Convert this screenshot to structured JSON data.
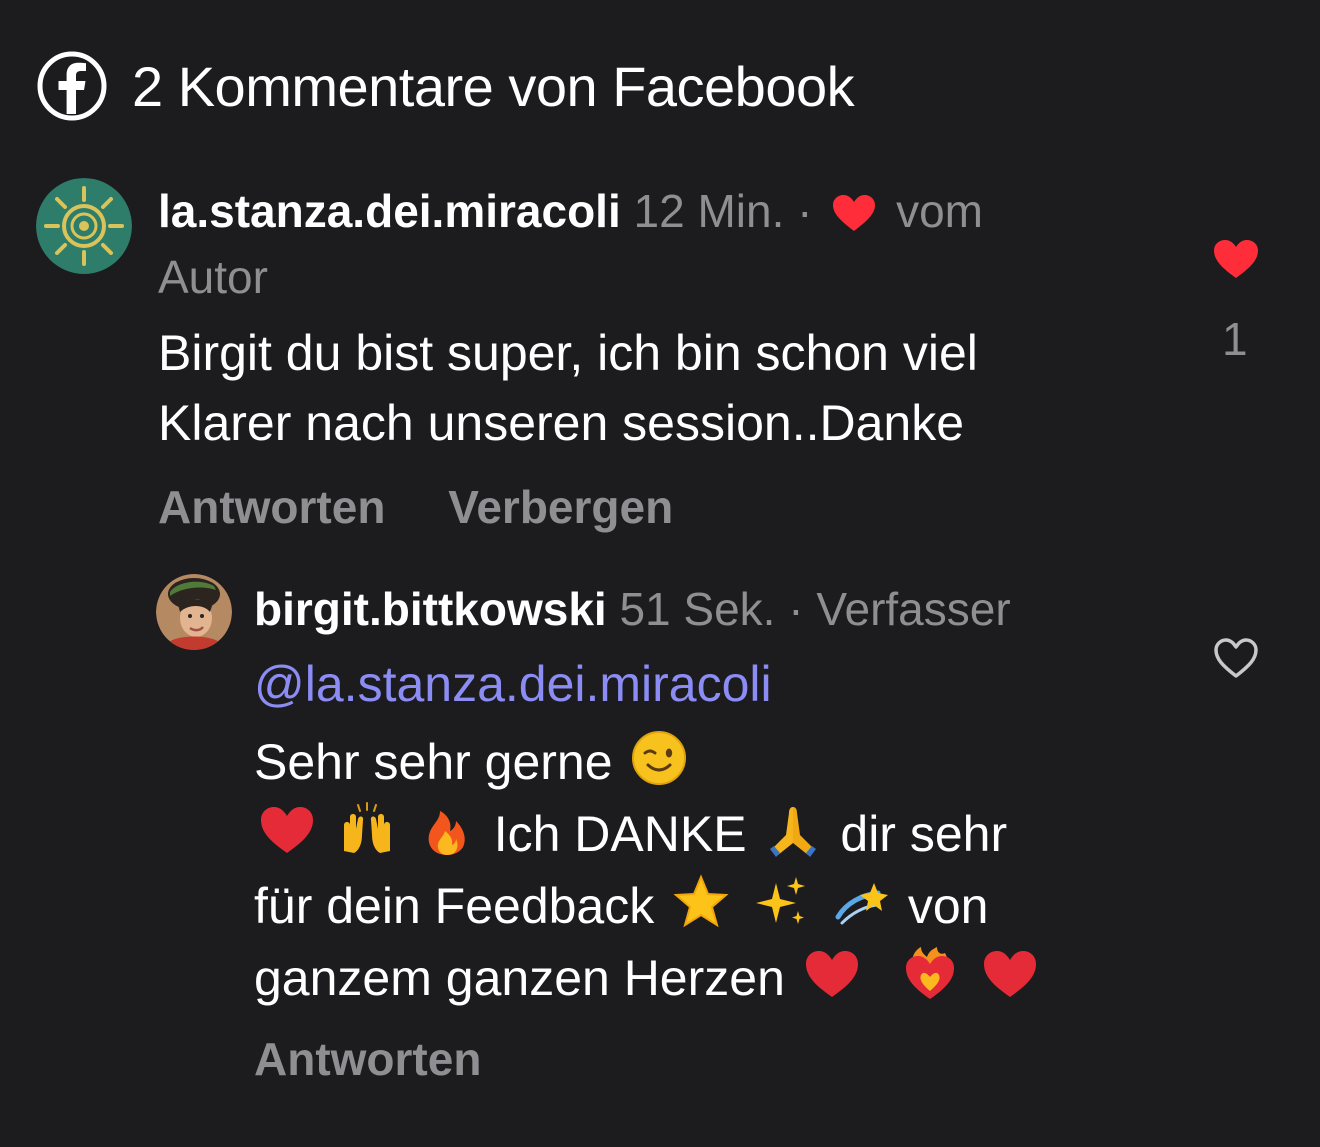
{
  "header": {
    "icon": "facebook-icon",
    "title": "2 Kommentare von Facebook"
  },
  "comments": [
    {
      "username": "la.stanza.dei.miracoli",
      "time": "12 Min.",
      "separator": "·",
      "liked_by_author_prefix": "vom",
      "liked_by_author_suffix": "Autor",
      "text_line1": "Birgit du bist super, ich bin schon viel",
      "text_line2": "Klarer nach unseren session..Danke",
      "actions": {
        "reply": "Antworten",
        "hide": "Verbergen"
      },
      "like_state": "liked",
      "like_count": "1"
    },
    {
      "username": "birgit.bittkowski",
      "time": "51 Sek.",
      "separator": "·",
      "role": "Verfasser",
      "mention": "@la.stanza.dei.miracoli",
      "line1": "Sehr sehr gerne",
      "line2_text": "Ich DANKE",
      "line2_tail": "dir sehr",
      "line3_text": "für dein Feedback",
      "line3_tail": "von",
      "line4_text": "ganzem ganzen Herzen",
      "emojis": [
        "winking-face",
        "red-heart",
        "raising-hands",
        "fire",
        "folded-hands",
        "star",
        "sparkles",
        "dizzy",
        "heart-on-fire"
      ],
      "actions": {
        "reply": "Antworten"
      },
      "like_state": "not-liked"
    }
  ],
  "colors": {
    "background": "#1c1c1e",
    "muted": "#8e8e93",
    "mention": "#8c8cf5",
    "like_red": "#ff2d3a"
  }
}
